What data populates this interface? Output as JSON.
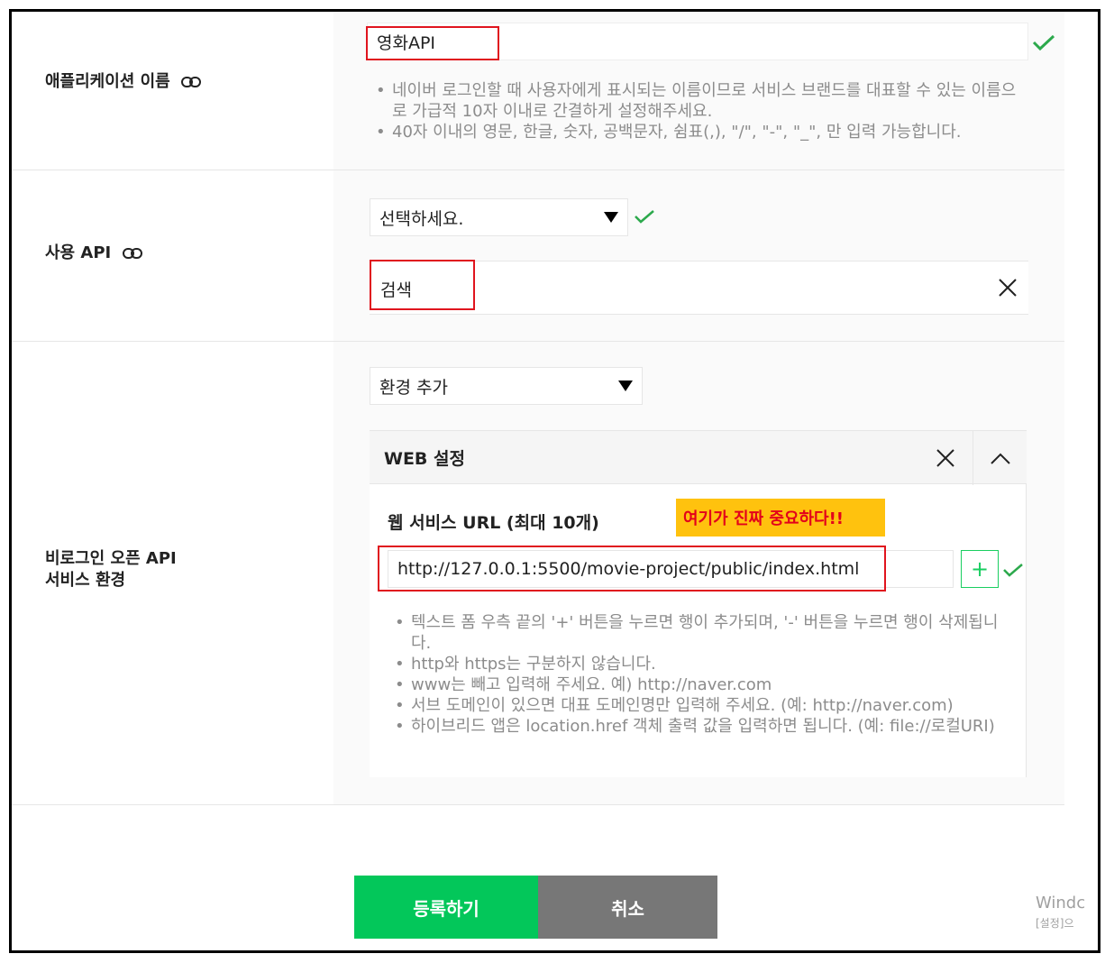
{
  "app_name": {
    "label": "애플리케이션 이름",
    "value": "영화API",
    "help": [
      "네이버 로그인할 때 사용자에게 표시되는 이름이므로 서비스 브랜드를 대표할 수 있는 이름으로 가급적 10자 이내로 간결하게 설정해주세요.",
      "40자 이내의 영문, 한글, 숫자, 공백문자, 쉼표(,), \"/\", \"-\", \"_\", 만 입력 가능합니다."
    ]
  },
  "api": {
    "label": "사용 API",
    "select_value": "선택하세요.",
    "selected_item": "검색"
  },
  "env": {
    "label_line1": "비로그인 오픈 API",
    "label_line2": "서비스 환경",
    "select_value": "환경 추가",
    "web": {
      "title": "WEB 설정",
      "url_title": "웹 서비스 URL (최대 10개)",
      "annotation": "여기가 진짜 중요하다!!",
      "url_value": "http://127.0.0.1:5500/movie-project/public/index.html",
      "plus_label": "+",
      "help": [
        "텍스트 폼 우측 끝의 '+' 버튼을 누르면 행이 추가되며, '-' 버튼을 누르면 행이 삭제됩니다.",
        "http와 https는 구분하지 않습니다.",
        "www는 빼고 입력해 주세요. 예) http://naver.com",
        "서브 도메인이 있으면 대표 도메인명만 입력해 주세요. (예: http://naver.com)",
        "하이브리드 앱은 location.href 객체 출력 값을 입력하면 됩니다. (예: file://로컬URI)"
      ]
    }
  },
  "buttons": {
    "register": "등록하기",
    "cancel": "취소"
  },
  "watermark": {
    "line1": "Windc",
    "line2": "[설정]으"
  },
  "colors": {
    "accent_green": "#03c75a",
    "annotation_red": "#e0141e",
    "annotation_yellow": "#ffc20e"
  }
}
